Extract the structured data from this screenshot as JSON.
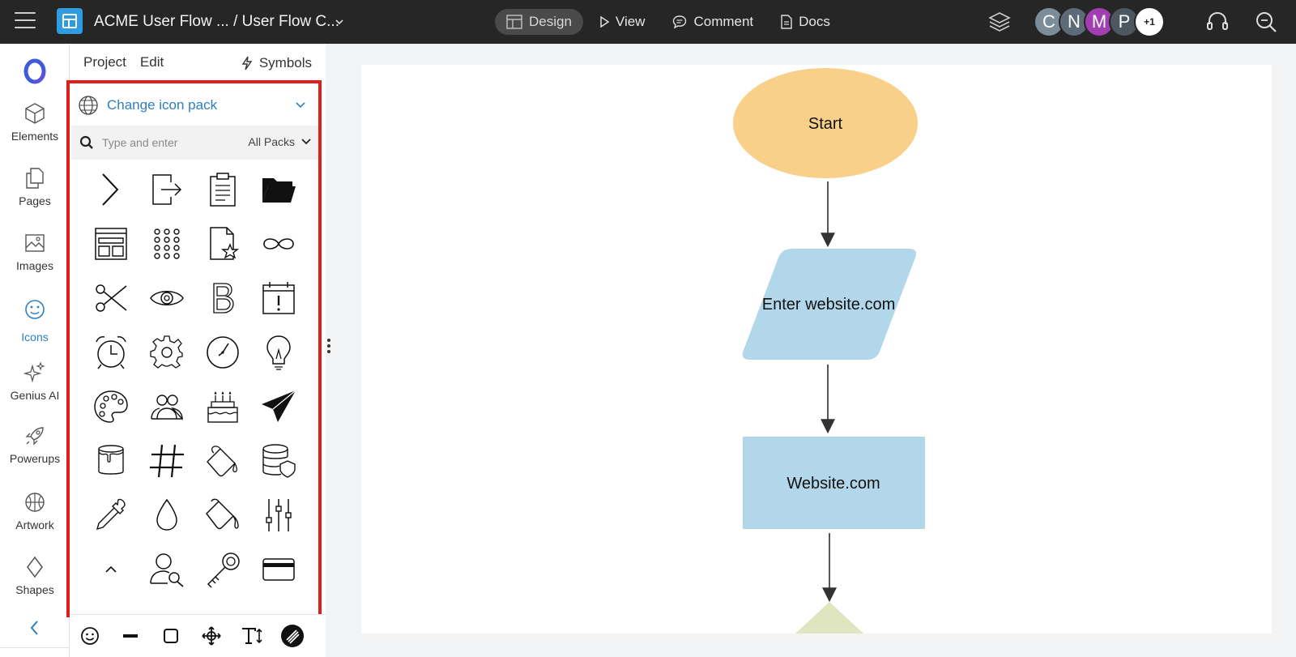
{
  "topbar": {
    "doc_title": "ACME User Flow ... / User Flow C...",
    "nav": [
      {
        "label": "Design",
        "active": true
      },
      {
        "label": "View",
        "active": false
      },
      {
        "label": "Comment",
        "active": false
      },
      {
        "label": "Docs",
        "active": false
      }
    ],
    "avatars": [
      {
        "initial": "C",
        "color": "#7c8c99"
      },
      {
        "initial": "N",
        "color": "#5c6b77"
      },
      {
        "initial": "M",
        "color": "#a23fb0"
      },
      {
        "initial": "P",
        "color": "#4d5760"
      },
      {
        "initial": "+1",
        "color": "#ffffff"
      }
    ]
  },
  "rail": {
    "items": [
      {
        "label": "Elements",
        "icon": "cube-icon",
        "active": false
      },
      {
        "label": "Pages",
        "icon": "pages-icon",
        "active": false
      },
      {
        "label": "Images",
        "icon": "image-icon",
        "active": false
      },
      {
        "label": "Icons",
        "icon": "smiley-icon",
        "active": true
      },
      {
        "label": "Genius AI",
        "icon": "sparkle-icon",
        "active": false
      },
      {
        "label": "Powerups",
        "icon": "rocket-icon",
        "active": false
      },
      {
        "label": "Artwork",
        "icon": "basketball-icon",
        "active": false
      },
      {
        "label": "Shapes",
        "icon": "diamond-icon",
        "active": false
      }
    ]
  },
  "panel": {
    "tabs": [
      "Project",
      "Edit"
    ],
    "symbols_label": "Symbols",
    "change_pack_label": "Change icon pack",
    "search_placeholder": "Type and enter",
    "pack_filter": "All Packs",
    "icons": [
      "chevron-right-icon",
      "exit-icon",
      "clipboard-icon",
      "folder-icon",
      "layout-icon",
      "dots-grid-icon",
      "document-star-icon",
      "infinity-icon",
      "scissors-icon",
      "eye-icon",
      "bold-icon",
      "calendar-alert-icon",
      "alarm-clock-icon",
      "gear-icon",
      "clock-icon",
      "lightbulb-icon",
      "palette-icon",
      "users-icon",
      "birthday-cake-icon",
      "paper-plane-icon",
      "paint-bucket-icon",
      "hashtag-icon",
      "paint-bucket-tilt-icon",
      "database-shield-icon",
      "eyedropper-icon",
      "droplet-icon",
      "paint-pour-icon",
      "sliders-icon",
      "caret-up-icon",
      "user-search-icon",
      "key-icon",
      "credit-card-icon"
    ],
    "bottom_tools": [
      "smiley-tool-icon",
      "line-tool-icon",
      "rectangle-tool-icon",
      "move-tool-icon",
      "text-tool-icon",
      "brand-tool-icon"
    ]
  },
  "canvas": {
    "shapes": [
      {
        "type": "ellipse",
        "label": "Start",
        "fill": "#f8d08a"
      },
      {
        "type": "parallelogram",
        "label": "Enter website.com",
        "fill": "#b2d7ea"
      },
      {
        "type": "rectangle",
        "label": "Website.com",
        "fill": "#b2d7ea"
      },
      {
        "type": "triangle",
        "label": "",
        "fill": "#dfe6bf"
      }
    ]
  }
}
